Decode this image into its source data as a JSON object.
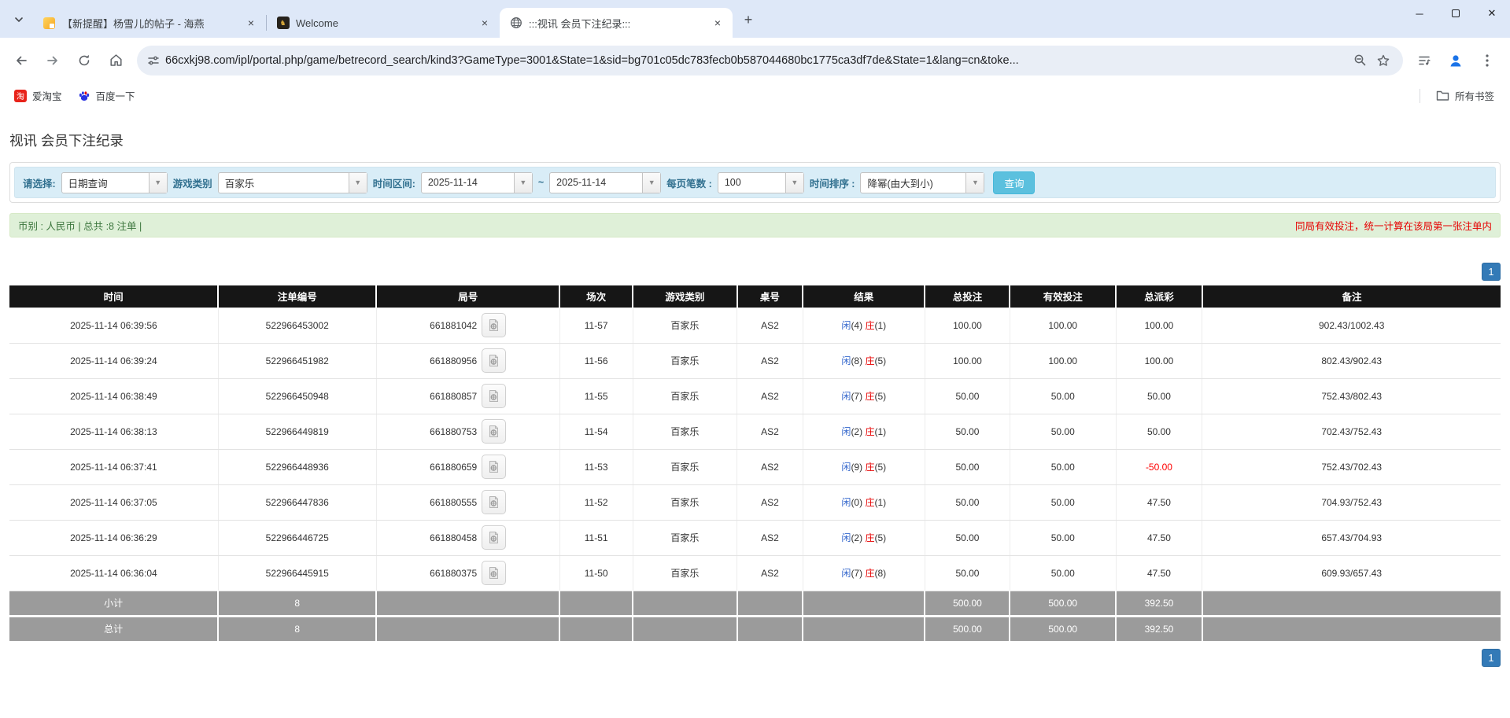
{
  "browser": {
    "tab_search_icon": "chevron-down",
    "tabs": [
      {
        "title": "【新提醒】杨雪儿的帖子 - 海燕",
        "favicon": "yellow-note",
        "active": false
      },
      {
        "title": "Welcome",
        "favicon": "dark-gold-emblem",
        "active": false
      },
      {
        "title": ":::视讯 会员下注纪录:::",
        "favicon": "globe",
        "active": true
      }
    ],
    "new_tab_label": "+",
    "window_controls": {
      "minimize": "–",
      "maximize": "",
      "close": "×"
    },
    "url": "66cxkj98.com/ipl/portal.php/game/betrecord_search/kind3?GameType=3001&State=1&sid=bg701c05dc783fecb0b587044680bc1775ca3df7de&State=1&lang=cn&toke...",
    "bookmarks": [
      {
        "label": "爱淘宝",
        "icon_text": "淘"
      },
      {
        "label": "百度一下"
      }
    ],
    "all_bookmarks_label": "所有书签"
  },
  "page": {
    "title": "视讯 会员下注纪录",
    "filters": {
      "select_label": "请选择:",
      "select_value": "日期查询",
      "game_type_label": "游戏类别",
      "game_type_value": "百家乐",
      "date_range_label": "时间区间:",
      "date_from": "2025-11-14",
      "tilde": "~",
      "date_to": "2025-11-14",
      "page_size_label": "每页笔数 :",
      "page_size_value": "100",
      "sort_label": "时间排序 :",
      "sort_value": "降幂(由大到小)",
      "search_button": "查询"
    },
    "summary_bar": {
      "left": "币别 : 人民币 | 总共 :8 注单 |",
      "right": "同局有效投注，统一计算在该局第一张注单内"
    },
    "pagination": {
      "current": "1"
    },
    "table": {
      "headers": [
        "时间",
        "注单编号",
        "局号",
        "场次",
        "游戏类别",
        "桌号",
        "结果",
        "总投注",
        "有效投注",
        "总派彩",
        "备注"
      ],
      "result_labels": {
        "player": "闲",
        "banker": "庄"
      },
      "rows": [
        {
          "time": "2025-11-14 06:39:56",
          "bet_no": "522966453002",
          "round_no": "661881042",
          "session": "11-57",
          "game_type": "百家乐",
          "table_no": "AS2",
          "player": "4",
          "banker": "1",
          "total_bet": "100.00",
          "valid_bet": "100.00",
          "payout": "100.00",
          "remark": "902.43/1002.43"
        },
        {
          "time": "2025-11-14 06:39:24",
          "bet_no": "522966451982",
          "round_no": "661880956",
          "session": "11-56",
          "game_type": "百家乐",
          "table_no": "AS2",
          "player": "8",
          "banker": "5",
          "total_bet": "100.00",
          "valid_bet": "100.00",
          "payout": "100.00",
          "remark": "802.43/902.43"
        },
        {
          "time": "2025-11-14 06:38:49",
          "bet_no": "522966450948",
          "round_no": "661880857",
          "session": "11-55",
          "game_type": "百家乐",
          "table_no": "AS2",
          "player": "7",
          "banker": "5",
          "total_bet": "50.00",
          "valid_bet": "50.00",
          "payout": "50.00",
          "remark": "752.43/802.43"
        },
        {
          "time": "2025-11-14 06:38:13",
          "bet_no": "522966449819",
          "round_no": "661880753",
          "session": "11-54",
          "game_type": "百家乐",
          "table_no": "AS2",
          "player": "2",
          "banker": "1",
          "total_bet": "50.00",
          "valid_bet": "50.00",
          "payout": "50.00",
          "remark": "702.43/752.43"
        },
        {
          "time": "2025-11-14 06:37:41",
          "bet_no": "522966448936",
          "round_no": "661880659",
          "session": "11-53",
          "game_type": "百家乐",
          "table_no": "AS2",
          "player": "9",
          "banker": "5",
          "total_bet": "50.00",
          "valid_bet": "50.00",
          "payout": "-50.00",
          "remark": "752.43/702.43"
        },
        {
          "time": "2025-11-14 06:37:05",
          "bet_no": "522966447836",
          "round_no": "661880555",
          "session": "11-52",
          "game_type": "百家乐",
          "table_no": "AS2",
          "player": "0",
          "banker": "1",
          "total_bet": "50.00",
          "valid_bet": "50.00",
          "payout": "47.50",
          "remark": "704.93/752.43"
        },
        {
          "time": "2025-11-14 06:36:29",
          "bet_no": "522966446725",
          "round_no": "661880458",
          "session": "11-51",
          "game_type": "百家乐",
          "table_no": "AS2",
          "player": "2",
          "banker": "5",
          "total_bet": "50.00",
          "valid_bet": "50.00",
          "payout": "47.50",
          "remark": "657.43/704.93"
        },
        {
          "time": "2025-11-14 06:36:04",
          "bet_no": "522966445915",
          "round_no": "661880375",
          "session": "11-50",
          "game_type": "百家乐",
          "table_no": "AS2",
          "player": "7",
          "banker": "8",
          "total_bet": "50.00",
          "valid_bet": "50.00",
          "payout": "47.50",
          "remark": "609.93/657.43"
        }
      ],
      "subtotal": {
        "label": "小计",
        "count": "8",
        "total_bet": "500.00",
        "valid_bet": "500.00",
        "payout": "392.50"
      },
      "total": {
        "label": "总计",
        "count": "8",
        "total_bet": "500.00",
        "valid_bet": "500.00",
        "payout": "392.50"
      }
    }
  },
  "colors": {
    "chrome_bg": "#dee8f8",
    "filter_strip_bg": "#d9edf7",
    "filter_label": "#31708f",
    "summary_bg": "#dff0d8",
    "summary_text": "#3c763d",
    "warning_text": "#e60000",
    "header_bg": "#161616",
    "link_blue": "#337ab7",
    "player_blue": "#3366cc",
    "banker_red": "#e60000",
    "negative_red": "#ff0000",
    "sum_row_bg": "#9b9b9b",
    "search_btn": "#5bc0de",
    "page_btn": "#337ab7"
  }
}
